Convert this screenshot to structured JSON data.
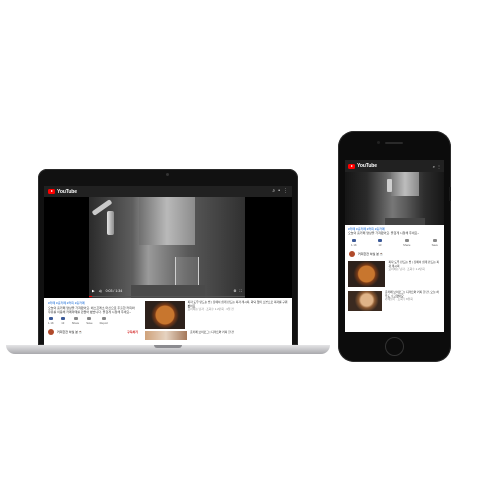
{
  "laptop": {
    "app_logo": "YouTube",
    "top_icons": {
      "search": "search-icon",
      "bell": "bell-icon",
      "menu": "more-vert-icon"
    },
    "player": {
      "time": "0:03 / 1:34"
    },
    "info": {
      "tag": "#카페 #홈카페 #커피 #홈카페",
      "description": "오늘의 홈카페 영상을 가져왔어요. 에스프레소 머신으로 추출한 커피와 우유를 이용해 카페라떼를 만들어 봤습니다. 즐겁게 시청해 주세요~",
      "actions": [
        "1.1K",
        "13",
        "Share",
        "Save",
        "Report"
      ],
      "channel_name": "커피한잔 하실 분 ☕",
      "subscribe": "구독하기"
    },
    "related": [
      {
        "title": "피자 도우 만드는 법 | 집에서 쉽게 만드는 피자 레시피, 화덕 없이 오븐으로 피자를 구워봤어요",
        "meta": "요리하는 남자 · 조회수 1.2만회 · 3일 전"
      },
      {
        "title": "홈카페 브이로그 | 디저트와 커피 한 잔",
        "meta": ""
      }
    ]
  },
  "phone": {
    "app_logo": "YouTube",
    "top_icons": {
      "search": "search-icon",
      "more": "more-vert-icon"
    },
    "tag": "#카페 #홈카페 #커피 #홈카페",
    "description": "오늘의 홈카페 영상을 가져왔어요. 즐겁게 시청해 주세요~",
    "actions": [
      "1.1K",
      "13",
      "Share",
      "Save"
    ],
    "channel_name": "커피한잔 하실 분 ☕",
    "related": [
      {
        "title": "피자 도우 만드는 법 | 집에서 쉽게 만드는 피자 레시피",
        "meta": "요리하는 남자 · 조회수 1.2만회"
      },
      {
        "title": "홈카페 브이로그 | 디저트와 커피 한 잔, 오늘 하루도 수고했어요",
        "meta": "카페일기 · 조회수 8천회"
      }
    ]
  }
}
